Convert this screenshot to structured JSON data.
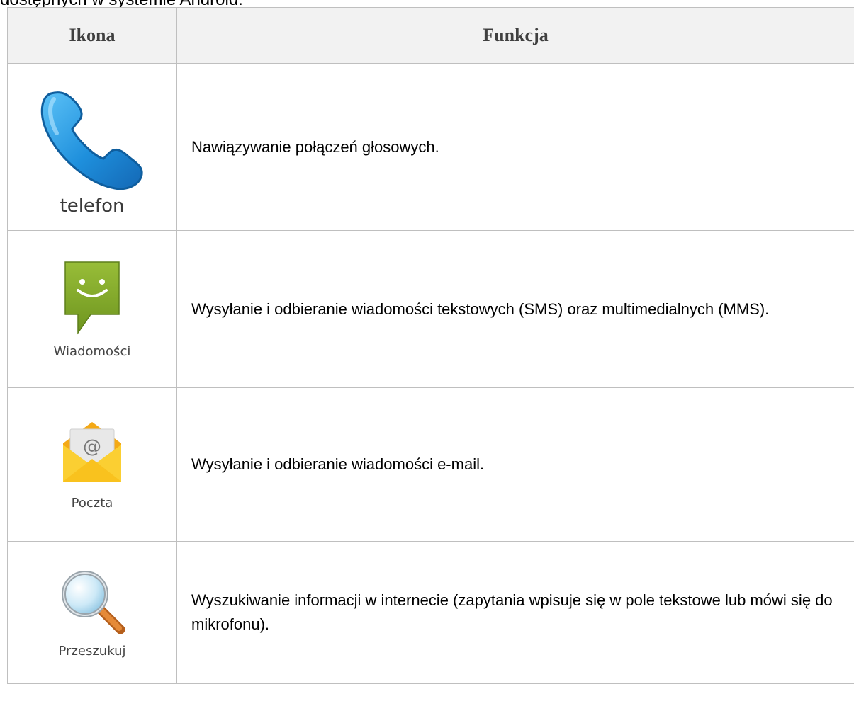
{
  "intro_text": "dostępnych w systemie Android.",
  "table": {
    "headers": {
      "icon": "Ikona",
      "function": "Funkcja"
    },
    "rows": [
      {
        "icon": "phone-icon",
        "label": "telefon",
        "description": "Nawiązywanie połączeń głosowych."
      },
      {
        "icon": "messages-icon",
        "label": "Wiadomości",
        "description": "Wysyłanie i odbieranie wiadomości tekstowych (SMS) oraz multimedialnych (MMS)."
      },
      {
        "icon": "mail-icon",
        "label": "Poczta",
        "description": "Wysyłanie i odbieranie wiadomości e-mail."
      },
      {
        "icon": "search-icon",
        "label": "Przeszukuj",
        "description": "Wyszukiwanie informacji w internecie (zapytania wpisuje się w pole tekstowe lub mówi się do mikrofonu)."
      }
    ]
  },
  "colors": {
    "phone": "#1e8fdc",
    "messages": "#7fa52a",
    "mail": "#f7c325",
    "search_handle": "#d9792b"
  }
}
